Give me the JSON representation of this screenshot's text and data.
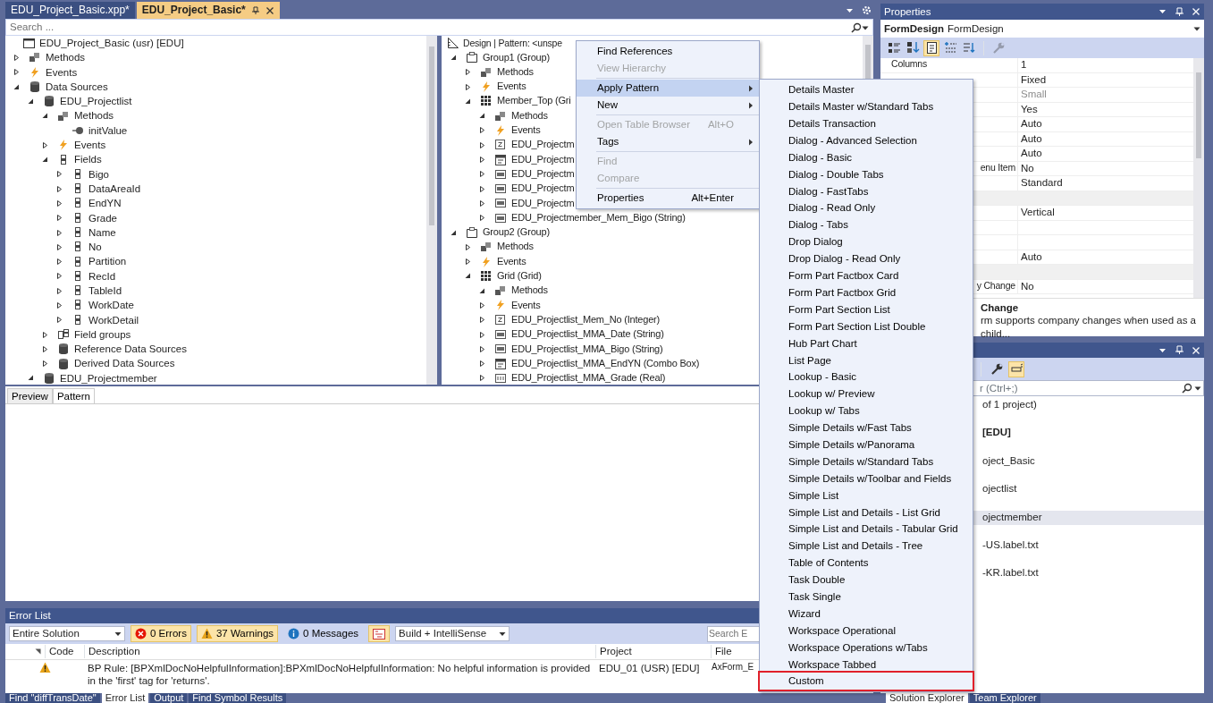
{
  "document_tabs": [
    {
      "label": "EDU_Project_Basic.xpp*",
      "selected": false
    },
    {
      "label": "EDU_Project_Basic*",
      "selected": true
    }
  ],
  "search": {
    "placeholder": "Search ..."
  },
  "data_tree": {
    "root": {
      "label": "EDU_Project_Basic (usr) [EDU]",
      "kind": "form"
    },
    "items": [
      {
        "label": "Methods",
        "kind": "methods",
        "expanded": false
      },
      {
        "label": "Events",
        "kind": "events",
        "expanded": false
      },
      {
        "label": "Data Sources",
        "kind": "datasource",
        "expanded": true,
        "children": [
          {
            "label": "EDU_Projectlist",
            "kind": "datasource",
            "expanded": true,
            "children": [
              {
                "label": "Methods",
                "kind": "methods",
                "expanded": true,
                "children": [
                  {
                    "label": "initValue",
                    "kind": "method"
                  }
                ]
              },
              {
                "label": "Events",
                "kind": "events",
                "expanded": false
              },
              {
                "label": "Fields",
                "kind": "field",
                "expanded": true,
                "children": [
                  {
                    "label": "Bigo",
                    "kind": "field",
                    "expanded": false
                  },
                  {
                    "label": "DataAreaId",
                    "kind": "field",
                    "expanded": false
                  },
                  {
                    "label": "EndYN",
                    "kind": "field",
                    "expanded": false
                  },
                  {
                    "label": "Grade",
                    "kind": "field",
                    "expanded": false
                  },
                  {
                    "label": "Name",
                    "kind": "field",
                    "expanded": false
                  },
                  {
                    "label": "No",
                    "kind": "field",
                    "expanded": false
                  },
                  {
                    "label": "Partition",
                    "kind": "field",
                    "expanded": false
                  },
                  {
                    "label": "RecId",
                    "kind": "field",
                    "expanded": false
                  },
                  {
                    "label": "TableId",
                    "kind": "field",
                    "expanded": false
                  },
                  {
                    "label": "WorkDate",
                    "kind": "field",
                    "expanded": false
                  },
                  {
                    "label": "WorkDetail",
                    "kind": "field",
                    "expanded": false
                  }
                ]
              },
              {
                "label": "Field groups",
                "kind": "fieldgroup",
                "expanded": false
              },
              {
                "label": "Reference Data Sources",
                "kind": "datasource",
                "expanded": false
              },
              {
                "label": "Derived Data Sources",
                "kind": "datasource",
                "expanded": false
              }
            ]
          },
          {
            "label": "EDU_Projectmember",
            "kind": "datasource",
            "expanded": true
          }
        ]
      }
    ]
  },
  "design_tree": {
    "header": "Design | Pattern: <unspe",
    "items": [
      {
        "label": "Group1 (Group)",
        "kind": "group",
        "expanded": true,
        "children": [
          {
            "label": "Methods",
            "kind": "methods",
            "expanded": false
          },
          {
            "label": "Events",
            "kind": "events",
            "expanded": false
          },
          {
            "label": "Member_Top (Gri",
            "kind": "grid",
            "expanded": true,
            "children": [
              {
                "label": "Methods",
                "kind": "methods",
                "expanded": true
              },
              {
                "label": "Events",
                "kind": "events",
                "expanded": false
              },
              {
                "label": "EDU_Projectm",
                "kind": "integer",
                "expanded": false
              },
              {
                "label": "EDU_Projectm",
                "kind": "combobox",
                "expanded": false
              },
              {
                "label": "EDU_Projectm",
                "kind": "string",
                "expanded": false
              },
              {
                "label": "EDU_Projectm",
                "kind": "string",
                "expanded": false
              },
              {
                "label": "EDU_Projectm",
                "kind": "string",
                "expanded": false
              },
              {
                "label": "EDU_Projectmember_Mem_Bigo (String)",
                "kind": "string",
                "expanded": false
              }
            ]
          }
        ]
      },
      {
        "label": "Group2 (Group)",
        "kind": "group",
        "expanded": true,
        "children": [
          {
            "label": "Methods",
            "kind": "methods",
            "expanded": false
          },
          {
            "label": "Events",
            "kind": "events",
            "expanded": false
          },
          {
            "label": "Grid (Grid)",
            "kind": "grid",
            "expanded": true,
            "children": [
              {
                "label": "Methods",
                "kind": "methods",
                "expanded": true
              },
              {
                "label": "Events",
                "kind": "events",
                "expanded": false
              },
              {
                "label": "EDU_Projectlist_Mem_No (Integer)",
                "kind": "integer",
                "expanded": false
              },
              {
                "label": "EDU_Projectlist_MMA_Date (String)",
                "kind": "string",
                "expanded": false
              },
              {
                "label": "EDU_Projectlist_MMA_Bigo (String)",
                "kind": "string",
                "expanded": false
              },
              {
                "label": "EDU_Projectlist_MMA_EndYN (Combo Box)",
                "kind": "combobox",
                "expanded": false
              },
              {
                "label": "EDU_Projectlist_MMA_Grade (Real)",
                "kind": "real",
                "expanded": false
              }
            ]
          }
        ]
      }
    ]
  },
  "designer_tabs": [
    {
      "label": "Preview",
      "selected": false
    },
    {
      "label": "Pattern",
      "selected": true
    }
  ],
  "error_list": {
    "title": "Error List",
    "scope": "Entire Solution",
    "filters": [
      {
        "label": "0 Errors",
        "kind": "error",
        "selected": true
      },
      {
        "label": "37 Warnings",
        "kind": "warning",
        "selected": true
      },
      {
        "label": "0 Messages",
        "kind": "info",
        "selected": false
      }
    ],
    "filter_button": {
      "selected": true
    },
    "source": "Build + IntelliSense",
    "search": {
      "placeholder": "Search E"
    },
    "columns": [
      "Code",
      "Description",
      "Project",
      "File"
    ],
    "rows": [
      {
        "kind": "warning",
        "description": "BP Rule: [BPXmlDocNoHelpfulInformation]:BPXmlDocNoHelpfulInformation: No helpful information is provided in the 'first' tag for 'returns'.",
        "project": "EDU_01 (USR) [EDU]",
        "file": "AxForm_E"
      }
    ]
  },
  "bottom_tabs_left": [
    {
      "label": "Find \"diffTransDate\"",
      "selected": false
    },
    {
      "label": "Error List",
      "selected": true
    },
    {
      "label": "Output",
      "selected": false
    },
    {
      "label": "Find Symbol Results",
      "selected": false
    }
  ],
  "properties": {
    "title": "Properties",
    "object": {
      "name": "FormDesign",
      "type": "FormDesign"
    },
    "toolbar": [
      {
        "kind": "categorized",
        "selected": false,
        "disabled": false
      },
      {
        "kind": "alphabetical",
        "selected": false,
        "disabled": false
      },
      {
        "kind": "pages",
        "selected": true,
        "disabled": false
      },
      {
        "kind": "expand",
        "selected": false,
        "disabled": false
      },
      {
        "kind": "sort",
        "selected": false,
        "disabled": false
      },
      {
        "kind": "wrench",
        "selected": false,
        "disabled": true
      }
    ],
    "rows": [
      {
        "kind": "property",
        "name": "Columns",
        "value": "1",
        "dimmed": false
      },
      {
        "kind": "property",
        "value": "Fixed",
        "dimmed": false
      },
      {
        "kind": "property",
        "value": "Small",
        "dimmed": true
      },
      {
        "kind": "property",
        "value": "Yes",
        "dimmed": false
      },
      {
        "kind": "property",
        "value": "Auto",
        "dimmed": false
      },
      {
        "kind": "property",
        "value": "Auto",
        "dimmed": false
      },
      {
        "kind": "property",
        "value": "Auto",
        "dimmed": false
      },
      {
        "kind": "property",
        "name": "enu Item",
        "value": "No",
        "dimmed": false
      },
      {
        "kind": "property",
        "value": "Standard",
        "dimmed": false
      },
      {
        "kind": "category"
      },
      {
        "kind": "property",
        "value": "Vertical",
        "dimmed": false
      },
      {
        "kind": "property"
      },
      {
        "kind": "property"
      },
      {
        "kind": "property",
        "value": "Auto",
        "dimmed": false
      },
      {
        "kind": "category"
      },
      {
        "kind": "property",
        "name": "y Change",
        "value": "No",
        "dimmed": false
      }
    ],
    "description": {
      "title": "Change",
      "text": "rm supports company changes when used as a child..."
    }
  },
  "solution_explorer": {
    "toolbar": [
      {
        "kind": "wrench",
        "selected": false
      },
      {
        "kind": "preview",
        "selected": true
      }
    ],
    "search": {
      "placeholder": "r (Ctrl+;)"
    },
    "rows": [
      {
        "text": "of 1 project)",
        "bold": false,
        "selected": false
      },
      {
        "text": "[EDU]",
        "bold": true,
        "selected": false
      },
      {
        "text": "oject_Basic",
        "bold": false,
        "selected": false
      },
      {
        "text": "ojectlist",
        "bold": false,
        "selected": false
      },
      {
        "text": "ojectmember",
        "bold": false,
        "selected": true
      },
      {
        "text": "-US.label.txt",
        "bold": false,
        "selected": false
      },
      {
        "text": "-KR.label.txt",
        "bold": false,
        "selected": false
      }
    ]
  },
  "bottom_tabs_right": [
    {
      "label": "Solution Explorer",
      "selected": true
    },
    {
      "label": "Team Explorer",
      "selected": false
    }
  ],
  "context_menu": {
    "items": [
      {
        "kind": "item",
        "label": "Find References",
        "disabled": false,
        "selected": false,
        "has_submenu": false
      },
      {
        "kind": "item",
        "label": "View Hierarchy",
        "disabled": true,
        "selected": false,
        "has_submenu": false
      },
      {
        "kind": "separator"
      },
      {
        "kind": "item",
        "label": "Apply Pattern",
        "disabled": false,
        "selected": true,
        "has_submenu": true
      },
      {
        "kind": "item",
        "label": "New",
        "disabled": false,
        "selected": false,
        "has_submenu": true
      },
      {
        "kind": "separator"
      },
      {
        "kind": "item",
        "label": "Open Table Browser",
        "shortcut": "Alt+O",
        "disabled": true,
        "selected": false,
        "has_submenu": false
      },
      {
        "kind": "item",
        "label": "Tags",
        "disabled": false,
        "selected": false,
        "has_submenu": true
      },
      {
        "kind": "separator"
      },
      {
        "kind": "item",
        "label": "Find",
        "disabled": true,
        "selected": false,
        "has_submenu": false
      },
      {
        "kind": "item",
        "label": "Compare",
        "disabled": true,
        "selected": false,
        "has_submenu": false
      },
      {
        "kind": "separator"
      },
      {
        "kind": "item",
        "label": "Properties",
        "shortcut": "Alt+Enter",
        "disabled": false,
        "selected": false,
        "has_submenu": false
      }
    ]
  },
  "submenu": {
    "items": [
      {
        "label": "Details Master",
        "outlined": false
      },
      {
        "label": "Details Master w/Standard Tabs",
        "outlined": false
      },
      {
        "label": "Details Transaction",
        "outlined": false
      },
      {
        "label": "Dialog - Advanced Selection",
        "outlined": false
      },
      {
        "label": "Dialog - Basic",
        "outlined": false
      },
      {
        "label": "Dialog - Double Tabs",
        "outlined": false
      },
      {
        "label": "Dialog - FastTabs",
        "outlined": false
      },
      {
        "label": "Dialog - Read Only",
        "outlined": false
      },
      {
        "label": "Dialog - Tabs",
        "outlined": false
      },
      {
        "label": "Drop Dialog",
        "outlined": false
      },
      {
        "label": "Drop Dialog - Read Only",
        "outlined": false
      },
      {
        "label": "Form Part Factbox Card",
        "outlined": false
      },
      {
        "label": "Form Part Factbox Grid",
        "outlined": false
      },
      {
        "label": "Form Part Section List",
        "outlined": false
      },
      {
        "label": "Form Part Section List Double",
        "outlined": false
      },
      {
        "label": "Hub Part Chart",
        "outlined": false
      },
      {
        "label": "List Page",
        "outlined": false
      },
      {
        "label": "Lookup - Basic",
        "outlined": false
      },
      {
        "label": "Lookup w/ Preview",
        "outlined": false
      },
      {
        "label": "Lookup w/ Tabs",
        "outlined": false
      },
      {
        "label": "Simple Details w/Fast Tabs",
        "outlined": false
      },
      {
        "label": "Simple Details w/Panorama",
        "outlined": false
      },
      {
        "label": "Simple Details w/Standard Tabs",
        "outlined": false
      },
      {
        "label": "Simple Details w/Toolbar and Fields",
        "outlined": false
      },
      {
        "label": "Simple List",
        "outlined": false
      },
      {
        "label": "Simple List and Details - List Grid",
        "outlined": false
      },
      {
        "label": "Simple List and Details - Tabular Grid",
        "outlined": false
      },
      {
        "label": "Simple List and Details - Tree",
        "outlined": false
      },
      {
        "label": "Table of Contents",
        "outlined": false
      },
      {
        "label": "Task Double",
        "outlined": false
      },
      {
        "label": "Task Single",
        "outlined": false
      },
      {
        "label": "Wizard",
        "outlined": false
      },
      {
        "label": "Workspace Operational",
        "outlined": false
      },
      {
        "label": "Workspace Operations w/Tabs",
        "outlined": false
      },
      {
        "label": "Workspace Tabbed",
        "outlined": false
      },
      {
        "label": "Custom",
        "outlined": true
      }
    ]
  }
}
